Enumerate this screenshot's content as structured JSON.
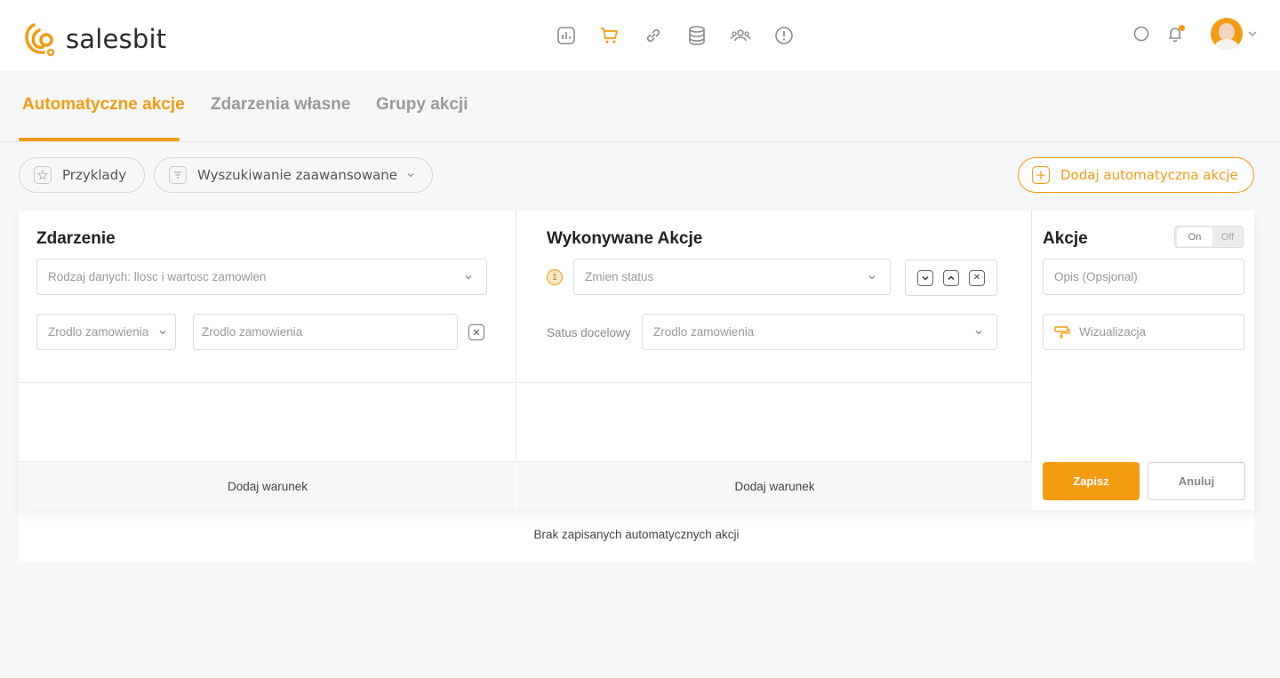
{
  "brand": {
    "name": "salesbit",
    "accent": "#f39c12"
  },
  "nav_icons": [
    "bar-chart-icon",
    "cart-icon",
    "link-icon",
    "database-icon",
    "users-icon",
    "alert-icon"
  ],
  "header": {
    "search_icon": "search-icon",
    "bell_icon": "bell-icon"
  },
  "tabs": [
    {
      "label": "Automatyczne akcje",
      "active": true
    },
    {
      "label": "Zdarzenia własne",
      "active": false
    },
    {
      "label": "Grupy akcji",
      "active": false
    }
  ],
  "toolbar": {
    "examples": "Przyklady",
    "advanced_search": "Wyszukiwanie zaawansowane",
    "add_action": "Dodaj automatyczna akcje"
  },
  "event_panel": {
    "title": "Zdarzenie",
    "data_type_placeholder": "Rodzaj danych: llosc i wartosc zamowlen",
    "source_select_placeholder": "Zrodlo zamowienia",
    "source_input_placeholder": "Zrodlo zamowienia",
    "add_condition": "Dodaj warunek"
  },
  "actions_panel": {
    "title": "Wykonywane Akcje",
    "step_number": "1",
    "status_placeholder": "Zmien status",
    "target_status_label": "Satus docelowy",
    "target_status_placeholder": "Zrodlo zamowienia",
    "add_condition": "Dodaj warunek"
  },
  "side_panel": {
    "title": "Akcje",
    "toggle_on": "On",
    "toggle_off": "Off",
    "description_placeholder": "Opis (Opsjonal)",
    "visualization_placeholder": "Wizualizacja",
    "save": "Zapisz",
    "cancel": "Anuluj"
  },
  "empty_message": "Brak zapisanych automatycznych akcji"
}
